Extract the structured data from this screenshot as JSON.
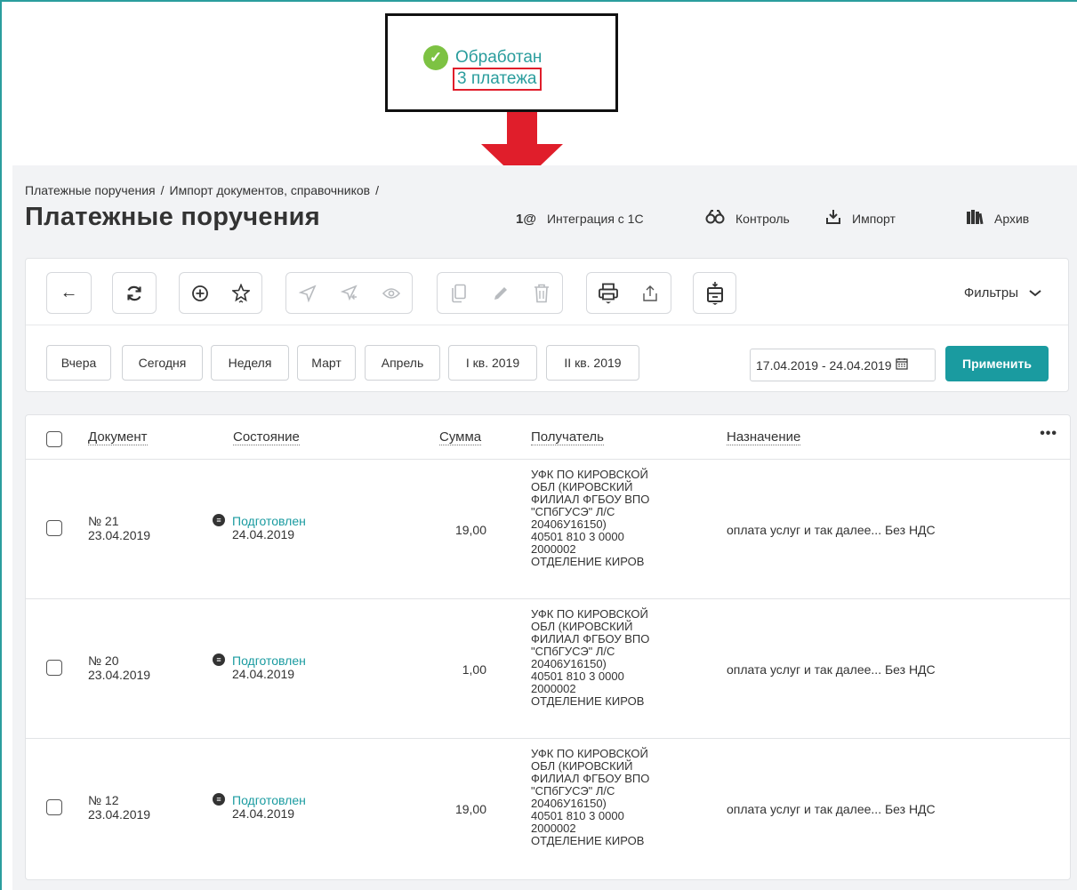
{
  "callout": {
    "status_text": "Обработан",
    "payments_link": "3 платежа"
  },
  "breadcrumb": {
    "items": [
      "Платежные поручения",
      "Импорт документов, справочников"
    ],
    "separator": "/"
  },
  "page_title": "Платежные поручения",
  "top_actions": {
    "integration": {
      "icon": "1@",
      "label": "Интеграция с 1С"
    },
    "control": {
      "icon": "binoculars-icon",
      "label": "Контроль"
    },
    "import": {
      "icon": "import-icon",
      "label": "Импорт"
    },
    "archive": {
      "icon": "archive-icon",
      "label": "Архив"
    }
  },
  "toolbar": {
    "filters_label": "Фильтры"
  },
  "periods": [
    "Вчера",
    "Сегодня",
    "Неделя",
    "Март",
    "Апрель",
    "I кв. 2019",
    "II кв. 2019"
  ],
  "date_range": "17.04.2019 - 24.04.2019",
  "apply_label": "Применить",
  "table": {
    "headers": {
      "document": "Документ",
      "state": "Состояние",
      "sum": "Сумма",
      "recipient": "Получатель",
      "purpose": "Назначение"
    },
    "rows": [
      {
        "number": "№ 21",
        "date": "23.04.2019",
        "state": "Подготовлен",
        "state_date": "24.04.2019",
        "sum": "19,00",
        "recipient": "УФК ПО КИРОВСКОЙ\nОБЛ (КИРОВСКИЙ\nФИЛИАЛ ФГБОУ ВПО\n\"СПбГУСЭ\" Л/С\n20406У16150)\n40501 810 3 0000\n2000002\nОТДЕЛЕНИЕ КИРОВ",
        "purpose": "оплата услуг и так далее... Без НДС"
      },
      {
        "number": "№ 20",
        "date": "23.04.2019",
        "state": "Подготовлен",
        "state_date": "24.04.2019",
        "sum": "1,00",
        "recipient": "УФК ПО КИРОВСКОЙ\nОБЛ (КИРОВСКИЙ\nФИЛИАЛ ФГБОУ ВПО\n\"СПбГУСЭ\" Л/С\n20406У16150)\n40501 810 3 0000\n2000002\nОТДЕЛЕНИЕ КИРОВ",
        "purpose": "оплата услуг и так далее... Без НДС"
      },
      {
        "number": "№ 12",
        "date": "23.04.2019",
        "state": "Подготовлен",
        "state_date": "24.04.2019",
        "sum": "19,00",
        "recipient": "УФК ПО КИРОВСКОЙ\nОБЛ (КИРОВСКИЙ\nФИЛИАЛ ФГБОУ ВПО\n\"СПбГУСЭ\" Л/С\n20406У16150)\n40501 810 3 0000\n2000002\nОТДЕЛЕНИЕ КИРОВ",
        "purpose": "оплата услуг и так далее... Без НДС"
      }
    ]
  },
  "colors": {
    "accent": "#1a9ba0",
    "highlight": "#e01e2b",
    "success": "#7dc243"
  }
}
